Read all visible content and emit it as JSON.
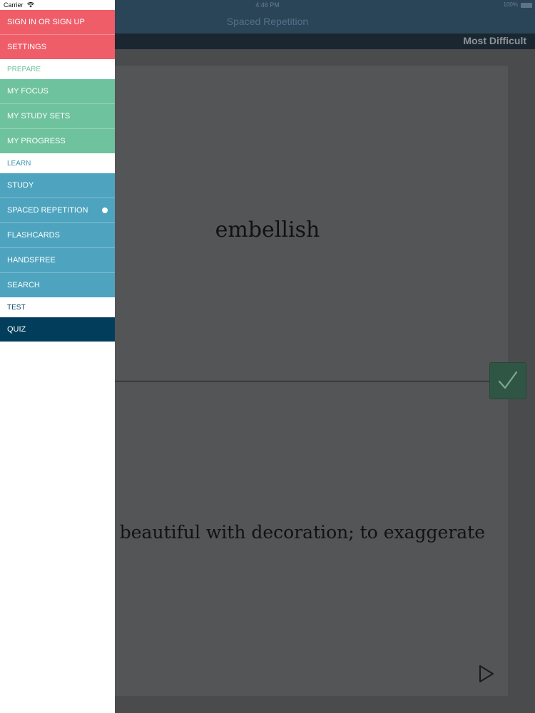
{
  "status": {
    "carrier": "Carrier",
    "time": "4:46 PM",
    "battery": "100%"
  },
  "nav": {
    "title": "Spaced Repetition",
    "filter_label": "Most Difficult"
  },
  "card": {
    "term": "embellish",
    "definition": "to make beautiful with decoration; to exaggerate"
  },
  "drawer": {
    "account": [
      {
        "label": "SIGN IN OR SIGN UP"
      },
      {
        "label": "SETTINGS"
      }
    ],
    "prepare_header": "PREPARE",
    "prepare": [
      {
        "label": "MY FOCUS"
      },
      {
        "label": "MY STUDY SETS"
      },
      {
        "label": "MY PROGRESS"
      }
    ],
    "learn_header": "LEARN",
    "learn": [
      {
        "label": "STUDY"
      },
      {
        "label": "SPACED REPETITION",
        "active": true
      },
      {
        "label": "FLASHCARDS"
      },
      {
        "label": "HANDSFREE"
      },
      {
        "label": "SEARCH"
      }
    ],
    "test_header": "TEST",
    "test": [
      {
        "label": "QUIZ"
      }
    ]
  },
  "colors": {
    "account": "#ef5d69",
    "prepare": "#6ec29e",
    "learn": "#4ea4bf",
    "test": "#023e5c"
  },
  "icons": {
    "wifi": "wifi-icon",
    "check": "checkmark-icon",
    "play": "play-icon",
    "active_indicator": "active-dot"
  }
}
